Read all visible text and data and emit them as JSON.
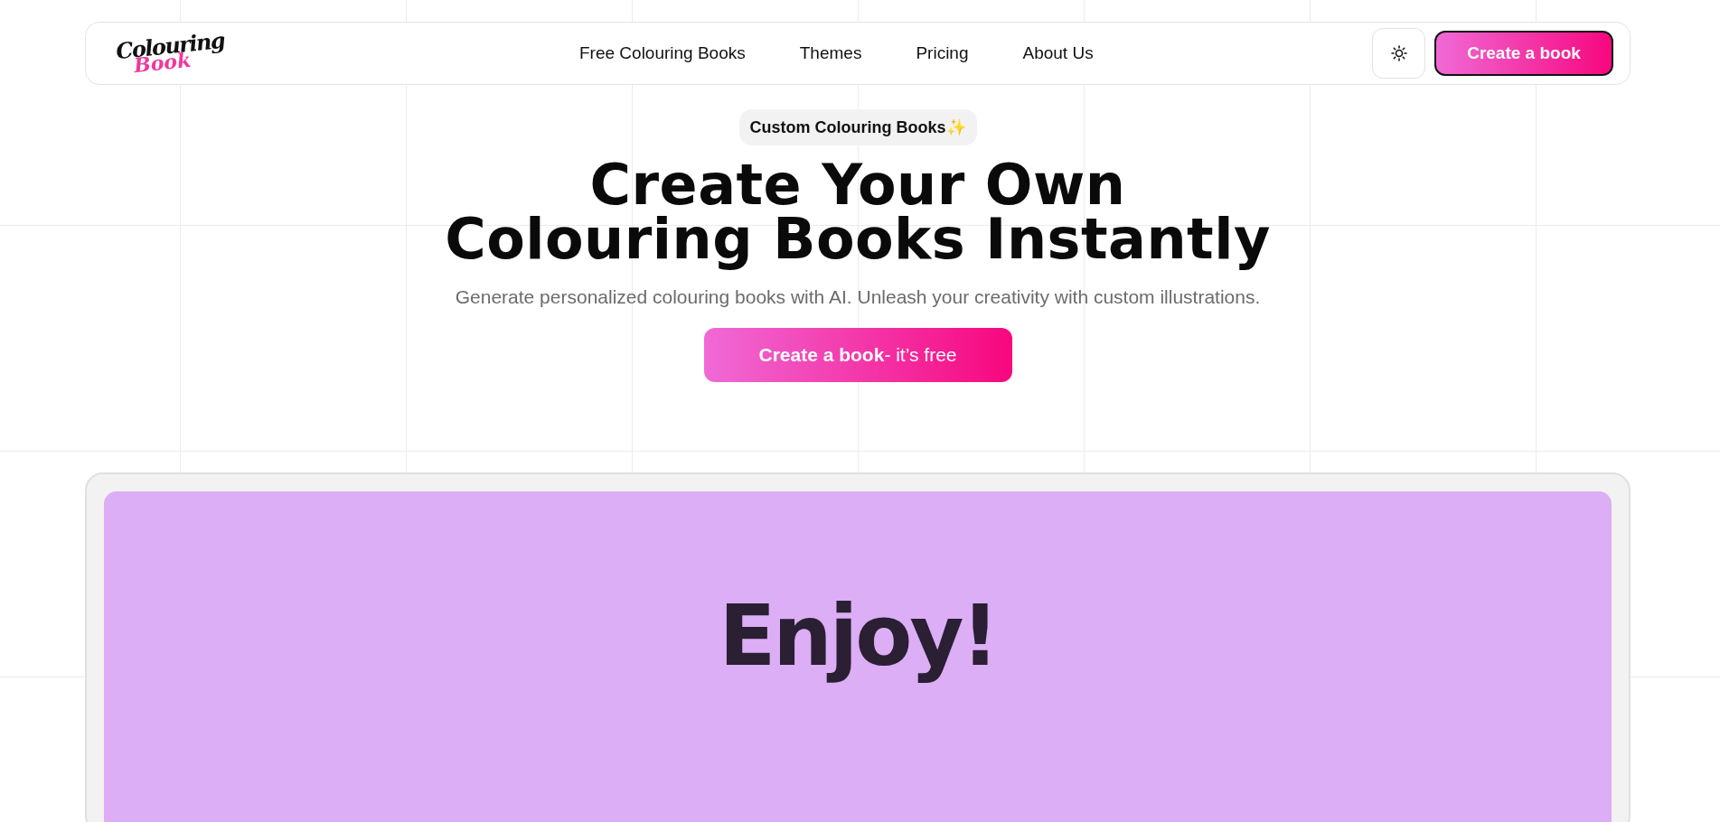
{
  "header": {
    "logo": {
      "line_1": "Colouring",
      "line_2": "Book"
    },
    "nav": [
      {
        "label": "Free Colouring Books"
      },
      {
        "label": "Themes"
      },
      {
        "label": "Pricing"
      },
      {
        "label": "About Us"
      }
    ],
    "cta": "Create a book"
  },
  "hero": {
    "badge": "Custom Colouring Books",
    "badge_emoji": "✨",
    "title_lines": [
      "Create Your Own",
      "Colouring Books Instantly"
    ],
    "subtitle": "Generate personalized colouring books with AI. Unleash your creativity with custom illustrations.",
    "button": "**Create a book**- it’s free"
  },
  "showcase": {
    "text": "Enjoy!"
  }
}
